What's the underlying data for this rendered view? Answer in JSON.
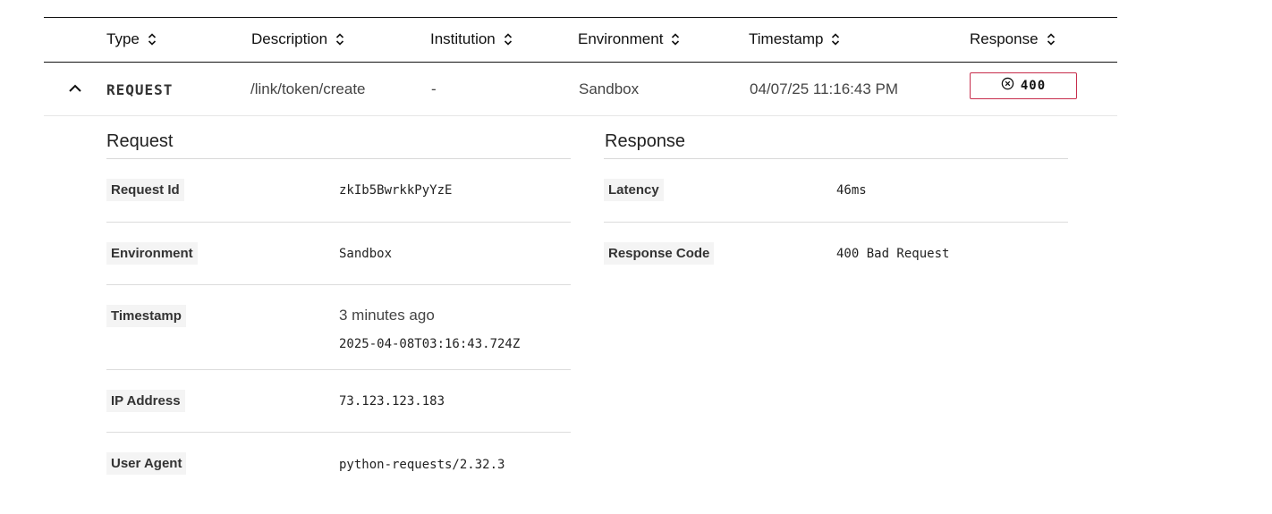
{
  "columns": {
    "type": "Type",
    "description": "Description",
    "institution": "Institution",
    "environment": "Environment",
    "timestamp": "Timestamp",
    "response": "Response"
  },
  "row": {
    "type": "REQUEST",
    "description": "/link/token/create",
    "institution": "-",
    "environment": "Sandbox",
    "timestamp": "04/07/25 11:16:43 PM",
    "response_code": "400",
    "response_icon": "x-circle-icon",
    "status_color": "#c72d4c"
  },
  "request": {
    "title": "Request",
    "request_id_label": "Request Id",
    "request_id": "zkIb5BwrkkPyYzE",
    "environment_label": "Environment",
    "environment": "Sandbox",
    "timestamp_label": "Timestamp",
    "timestamp_relative": "3 minutes ago",
    "timestamp_iso": "2025-04-08T03:16:43.724Z",
    "ip_label": "IP Address",
    "ip": "73.123.123.183",
    "user_agent_label": "User Agent",
    "user_agent": "python-requests/2.32.3"
  },
  "response": {
    "title": "Response",
    "latency_label": "Latency",
    "latency": "46ms",
    "code_label": "Response Code",
    "code": "400 Bad Request"
  }
}
